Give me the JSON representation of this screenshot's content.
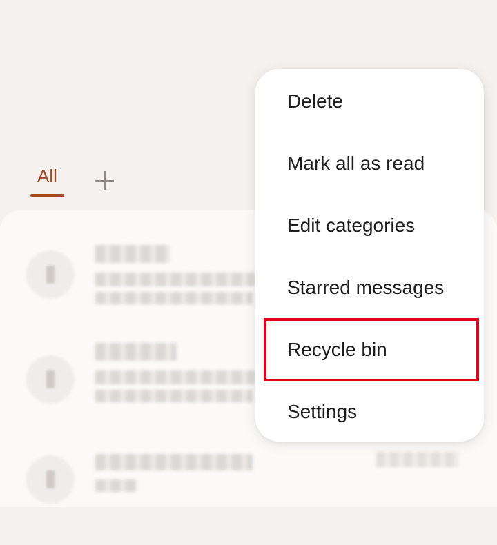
{
  "tabs": {
    "all_label": "All",
    "add_icon": "plus-icon"
  },
  "overflow_menu": {
    "items": [
      {
        "label": "Delete"
      },
      {
        "label": "Mark all as read"
      },
      {
        "label": "Edit categories"
      },
      {
        "label": "Starred messages"
      },
      {
        "label": "Recycle bin"
      },
      {
        "label": "Settings"
      }
    ],
    "highlighted_index": 4,
    "highlight_color": "#e3001b"
  },
  "colors": {
    "accent": "#a3471e",
    "background": "#f4f1ee",
    "menu_background": "#ffffff"
  }
}
